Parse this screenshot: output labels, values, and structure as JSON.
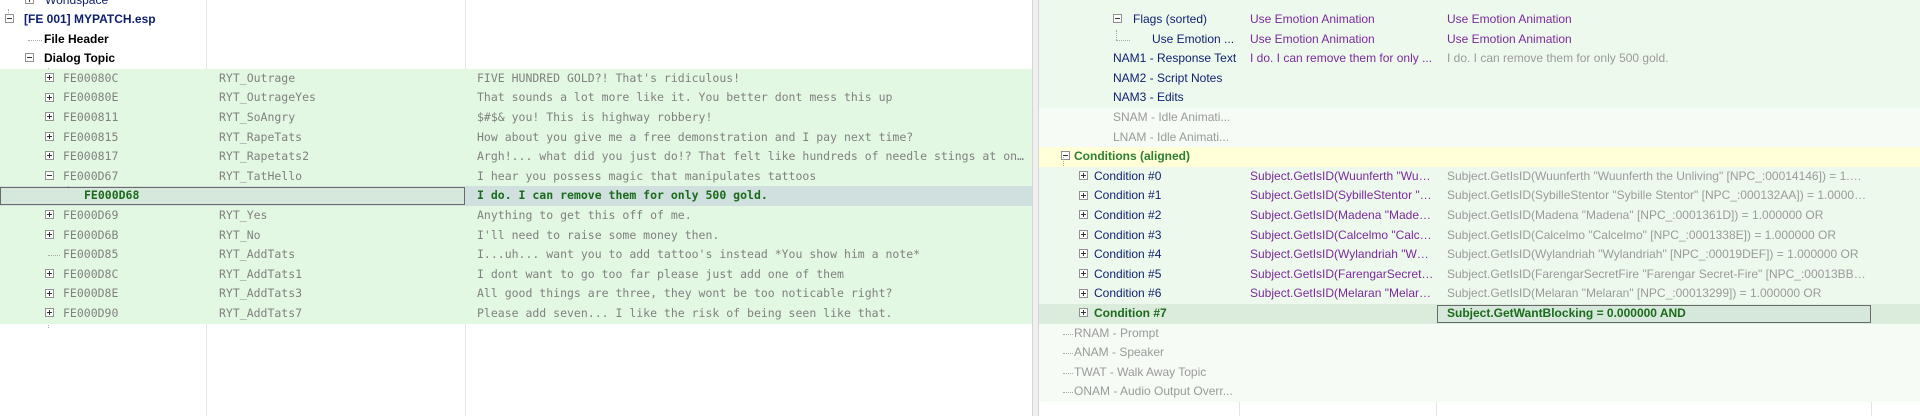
{
  "left": {
    "workspace_label": "Worldspace",
    "plugin_label": "[FE 001] MYPATCH.esp",
    "file_header_label": "File Header",
    "dialog_topic_label": "Dialog Topic",
    "rows": [
      {
        "form_id": "FE00080C",
        "editor_id": "RYT_Outrage",
        "text": "FIVE HUNDRED GOLD?! That's ridiculous!"
      },
      {
        "form_id": "FE00080E",
        "editor_id": "RYT_OutrageYes",
        "text": "That sounds a lot more like it. You better dont mess this up"
      },
      {
        "form_id": "FE000811",
        "editor_id": "RYT_SoAngry",
        "text": "$#$& you! This is highway robbery!"
      },
      {
        "form_id": "FE000815",
        "editor_id": "RYT_RapeTats",
        "text": "How about you give me a free demonstration and I pay next time?"
      },
      {
        "form_id": "FE000817",
        "editor_id": "RYT_Rapetats2",
        "text": "Argh!... what did you just do!? That felt like hundreds of needle stings at once. *You take a look at y..."
      },
      {
        "form_id": "FE000D67",
        "editor_id": "RYT_TatHello",
        "text": "I hear you possess magic that manipulates tattoos"
      },
      {
        "form_id": "FE000D68",
        "editor_id": "",
        "text": "I do. I can remove them for only 500 gold."
      },
      {
        "form_id": "FE000D69",
        "editor_id": "RYT_Yes",
        "text": "Anything to get this off of me."
      },
      {
        "form_id": "FE000D6B",
        "editor_id": "RYT_No",
        "text": "I'll need to raise some money then."
      },
      {
        "form_id": "FE000D85",
        "editor_id": "RYT_AddTats",
        "text": "I...uh... want you to add tattoo's instead *You show him a note*"
      },
      {
        "form_id": "FE000D8C",
        "editor_id": "RYT_AddTats1",
        "text": "I dont want to go too far please just add one of them"
      },
      {
        "form_id": "FE000D8E",
        "editor_id": "RYT_AddTats3",
        "text": "All good things are three, they wont be too noticable right?"
      },
      {
        "form_id": "FE000D90",
        "editor_id": "RYT_AddTats7",
        "text": "Please add seven... I like the risk of being seen like that."
      }
    ]
  },
  "right": {
    "rows": [
      {
        "label": "Flags (sorted)",
        "col1": "Use Emotion Animation",
        "col2": "Use Emotion Animation"
      },
      {
        "label": "Use Emotion ...",
        "col1": "Use Emotion Animation",
        "col2": "Use Emotion Animation"
      },
      {
        "label": "NAM1 - Response Text",
        "col1": "I do. I can remove them for only ...",
        "col2": "I do. I can remove them for only 500 gold."
      },
      {
        "label": "NAM2 - Script Notes",
        "col1": "",
        "col2": ""
      },
      {
        "label": "NAM3 - Edits",
        "col1": "",
        "col2": ""
      },
      {
        "label": "SNAM - Idle Animati...",
        "col1": "",
        "col2": ""
      },
      {
        "label": "LNAM - Idle Animati...",
        "col1": "",
        "col2": ""
      }
    ],
    "conditions_label": "Conditions (aligned)",
    "conditions": [
      {
        "label": "Condition #0",
        "col1": "Subject.GetIsID(Wuunferth \"Wuu...",
        "col2": "Subject.GetIsID(Wuunferth \"Wuunferth the Unliving\" [NPC_:00014146]) = 1.0000..."
      },
      {
        "label": "Condition #1",
        "col1": "Subject.GetIsID(SybilleStentor \"S...",
        "col2": "Subject.GetIsID(SybilleStentor \"Sybille Stentor\" [NPC_:000132AA]) = 1.000000 OR"
      },
      {
        "label": "Condition #2",
        "col1": "Subject.GetIsID(Madena \"Maden...",
        "col2": "Subject.GetIsID(Madena \"Madena\" [NPC_:0001361D]) = 1.000000 OR"
      },
      {
        "label": "Condition #3",
        "col1": "Subject.GetIsID(Calcelmo \"Calcel...",
        "col2": "Subject.GetIsID(Calcelmo \"Calcelmo\" [NPC_:0001338E]) = 1.000000 OR"
      },
      {
        "label": "Condition #4",
        "col1": "Subject.GetIsID(Wylandriah \"Wyl...",
        "col2": "Subject.GetIsID(Wylandriah \"Wylandriah\" [NPC_:00019DEF]) = 1.000000 OR"
      },
      {
        "label": "Condition #5",
        "col1": "Subject.GetIsID(FarengarSecretFi...",
        "col2": "Subject.GetIsID(FarengarSecretFire \"Farengar Secret-Fire\" [NPC_:00013BBB]) = 1...."
      },
      {
        "label": "Condition #6",
        "col1": "Subject.GetIsID(Melaran \"Melara...",
        "col2": "Subject.GetIsID(Melaran \"Melaran\" [NPC_:00013299]) = 1.000000 OR"
      },
      {
        "label": "Condition #7",
        "col1": "",
        "col2": "Subject.GetWantBlocking = 0.000000 AND"
      }
    ],
    "tail": [
      {
        "label": "RNAM - Prompt"
      },
      {
        "label": "ANAM - Speaker"
      },
      {
        "label": "TWAT - Walk Away Topic"
      },
      {
        "label": "ONAM - Audio Output Overr..."
      }
    ]
  }
}
